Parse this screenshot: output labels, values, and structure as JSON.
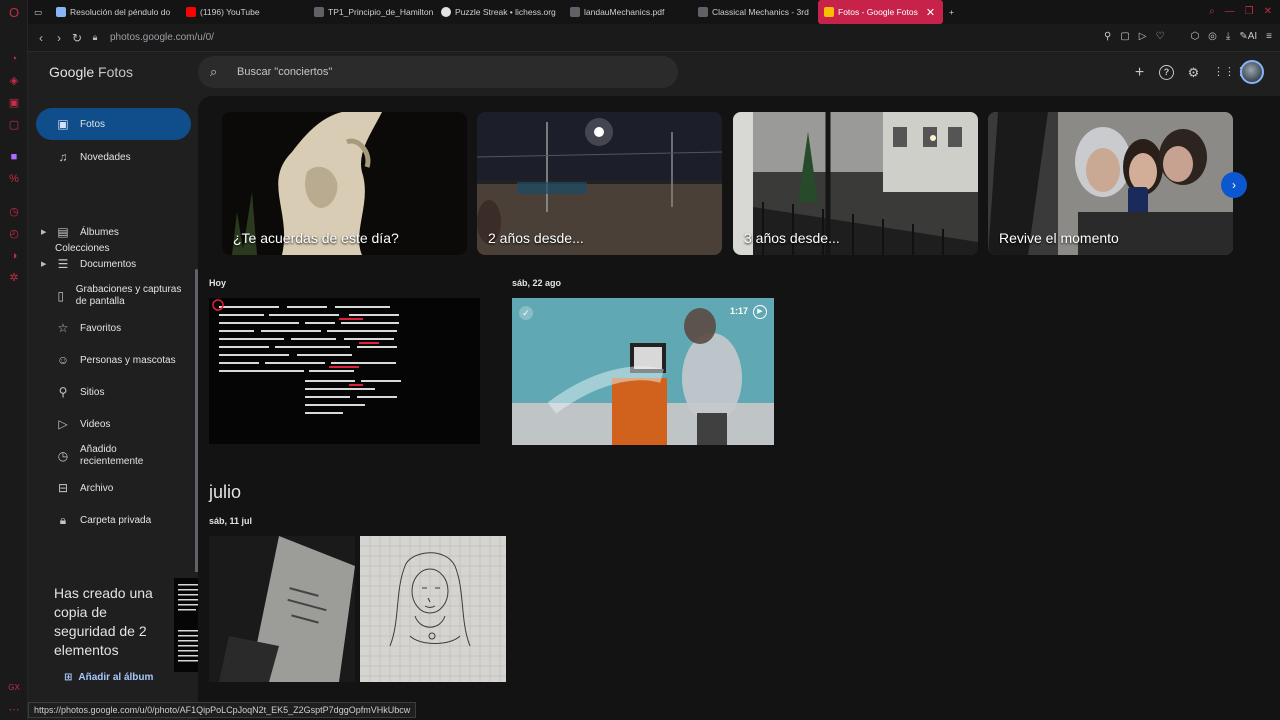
{
  "browser": {
    "tabs": [
      {
        "label": "Resolución del péndulo do",
        "color": "#8ab4f8"
      },
      {
        "label": "(1196) YouTube",
        "color": "#ff0000"
      },
      {
        "label": "TP1_Principio_de_Hamilton",
        "color": "#5f6368"
      },
      {
        "label": "Puzzle Streak • lichess.org",
        "color": "#e3e3e3"
      },
      {
        "label": "landauMechanics.pdf",
        "color": "#5f6368"
      },
      {
        "label": "Classical Mechanics - 3rd",
        "color": "#5f6368"
      },
      {
        "label": "Fotos - Google Fotos",
        "color": "#fbbc04"
      }
    ],
    "url": "photos.google.com/u/0/",
    "new_tab": "+",
    "status_url": "https://photos.google.com/u/0/photo/AF1QipPoLCpJoqN2t_EK5_Z2GsptP7dggOpfmVHkUbcw"
  },
  "header": {
    "logo_google": "Google",
    "logo_fotos": "Fotos",
    "search_placeholder": "Buscar \"conciertos\""
  },
  "sidebar": {
    "items": [
      {
        "label": "Fotos"
      },
      {
        "label": "Novedades"
      }
    ],
    "section_title": "Colecciones",
    "collections": [
      {
        "label": "Álbumes"
      },
      {
        "label": "Documentos"
      },
      {
        "label": "Grabaciones y capturas de pantalla"
      },
      {
        "label": "Favoritos"
      },
      {
        "label": "Personas y mascotas"
      },
      {
        "label": "Sitios"
      },
      {
        "label": "Videos"
      },
      {
        "label": "Añadido recientemente"
      },
      {
        "label": "Archivo"
      },
      {
        "label": "Carpeta privada"
      }
    ]
  },
  "toast": {
    "message": "Has creado una copia de seguridad de 2 elementos",
    "action": "Añadir al álbum",
    "close": "×"
  },
  "memories": [
    {
      "label": "¿Te acuerdas de este día?"
    },
    {
      "label": "2 años desde..."
    },
    {
      "label": "3 años desde..."
    },
    {
      "label": "Revive el momento"
    }
  ],
  "groups": {
    "today": "Hoy",
    "aug": "sáb, 22 ago",
    "video_duration": "1:17",
    "month": "julio",
    "jul_date": "sáb, 11 jul"
  },
  "colors": {
    "accent": "#0b57d0",
    "active_nav": "#0f4d8b",
    "tab_active": "#c7234a",
    "link": "#a8c7fa"
  }
}
